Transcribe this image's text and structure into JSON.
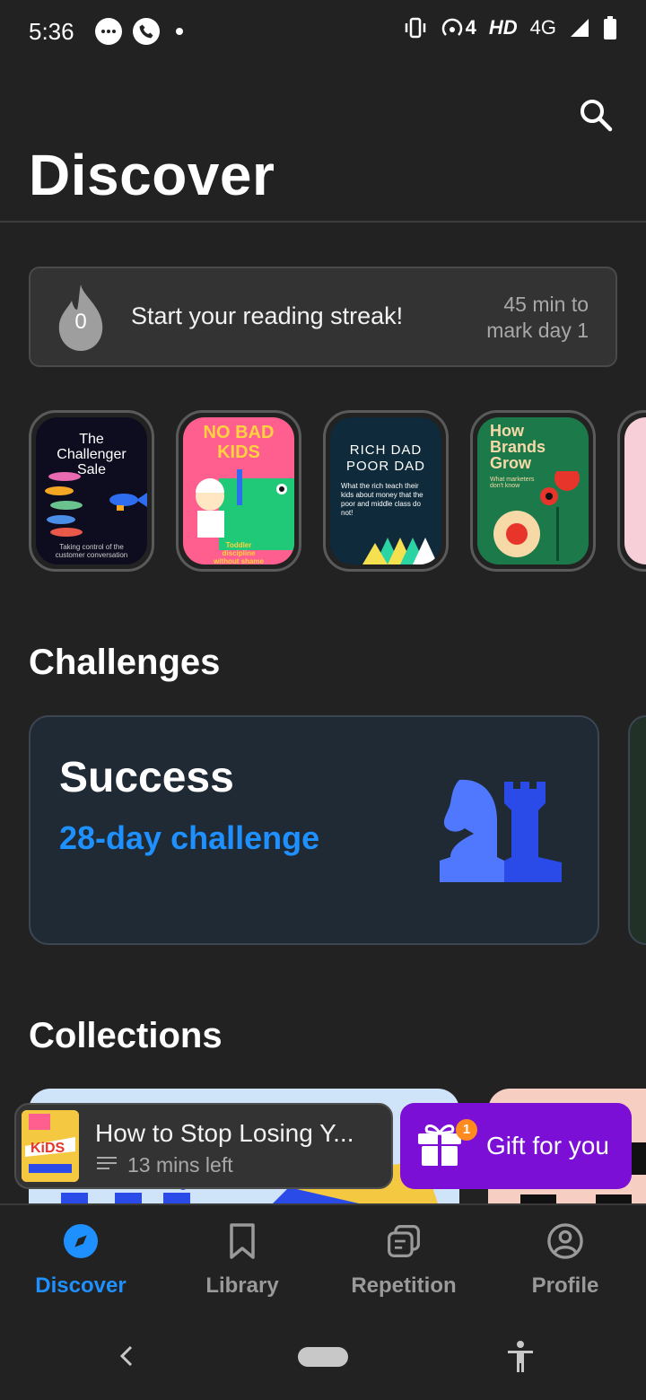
{
  "status_bar": {
    "time": "5:36",
    "left_icons": [
      "chat-bubble-icon",
      "phone-icon",
      "notification-dot-icon"
    ],
    "right_icons": [
      "vibrate-icon",
      "hotspot-icon",
      "signal-icon",
      "battery-icon"
    ],
    "hotspot_count": "4",
    "network_hd": "HD",
    "network_4g": "4G"
  },
  "header": {
    "title": "Discover",
    "search_icon": "search-icon"
  },
  "streak": {
    "count": "0",
    "text": "Start your reading streak!",
    "sub": "45 min to mark day 1"
  },
  "stories": [
    {
      "title": "The Challenger Sale",
      "subtitle": "Taking control of the customer conversation",
      "bg": "#0d0d1f"
    },
    {
      "title": "NO BAD KIDS",
      "subtitle": "Toddler discipline without shame",
      "bg": "#ff5f8f"
    },
    {
      "title": "RICH DAD POOR DAD",
      "subtitle": "What the rich teach their kids about money that the poor and middle class do not!",
      "bg": "#0f2a3a"
    },
    {
      "title": "How Brands Grow",
      "subtitle": "What marketers don't know",
      "bg": "#1c7a4a"
    }
  ],
  "challenges": {
    "section_title": "Challenges",
    "card": {
      "title": "Success",
      "subtitle": "28-day challenge",
      "icon": "chess-pieces-icon"
    }
  },
  "collections": {
    "section_title": "Collections"
  },
  "mini_player": {
    "title": "How to Stop Losing Y...",
    "time_left": "13 mins left",
    "cover_text": "KiDS"
  },
  "gift": {
    "label": "Gift for you",
    "badge": "1"
  },
  "bottom_nav": [
    {
      "label": "Discover",
      "icon": "compass-icon",
      "active": true
    },
    {
      "label": "Library",
      "icon": "bookmark-icon",
      "active": false
    },
    {
      "label": "Repetition",
      "icon": "cards-icon",
      "active": false
    },
    {
      "label": "Profile",
      "icon": "profile-icon",
      "active": false
    }
  ],
  "colors": {
    "background": "#222222",
    "accent_blue": "#1e90ff",
    "gift_purple": "#7b0fd6",
    "card_dark": "#1f2a35"
  }
}
